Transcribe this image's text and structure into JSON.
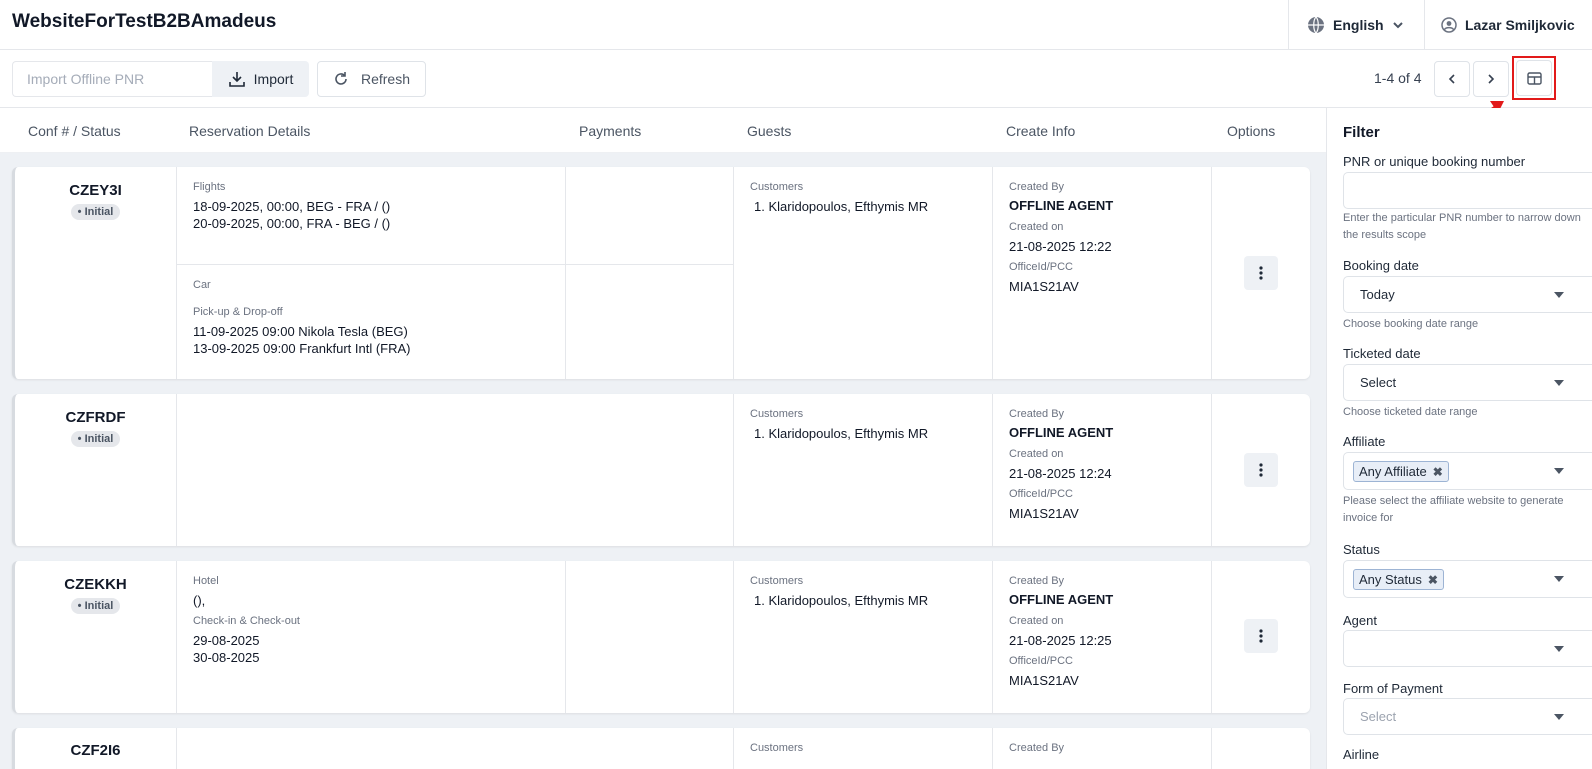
{
  "header": {
    "app_title": "WebsiteForTestB2BAmadeus",
    "language": "English",
    "user_name": "Lazar Smiljkovic"
  },
  "toolbar": {
    "pnr_placeholder": "Import Offline PNR",
    "import_label": "Import",
    "refresh_label": "Refresh",
    "pager_text": "1-4 of 4"
  },
  "columns": {
    "conf_status": "Conf # / Status",
    "reservation_details": "Reservation Details",
    "payments": "Payments",
    "guests": "Guests",
    "create_info": "Create Info",
    "options": "Options"
  },
  "bookings": [
    {
      "conf": "CZEY3I",
      "status": "• Initial",
      "flights_label": "Flights",
      "flight_1": "18-09-2025, 00:00, BEG - FRA / ()",
      "flight_2": "20-09-2025, 00:00, FRA - BEG / ()",
      "car_label": "Car",
      "pickup_label": "Pick-up & Drop-off",
      "pickup_1": "11-09-2025 09:00 Nikola Tesla (BEG)",
      "pickup_2": "13-09-2025 09:00 Frankfurt Intl (FRA)",
      "customers_label": "Customers",
      "customer": "1. Klaridopoulos, Efthymis MR",
      "created_by_label": "Created By",
      "created_by": "OFFLINE AGENT",
      "created_on_label": "Created on",
      "created_on": "21-08-2025 12:22",
      "office_label": "OfficeId/PCC",
      "office": "MIA1S21AV"
    },
    {
      "conf": "CZFRDF",
      "status": "• Initial",
      "customers_label": "Customers",
      "customer": "1. Klaridopoulos, Efthymis MR",
      "created_by_label": "Created By",
      "created_by": "OFFLINE AGENT",
      "created_on_label": "Created on",
      "created_on": "21-08-2025 12:24",
      "office_label": "OfficeId/PCC",
      "office": "MIA1S21AV"
    },
    {
      "conf": "CZEKKH",
      "status": "• Initial",
      "hotel_label": "Hotel",
      "hotel_name": "(),",
      "checkin_label": "Check-in & Check-out",
      "checkin": "29-08-2025",
      "checkout": "30-08-2025",
      "customers_label": "Customers",
      "customer": "1. Klaridopoulos, Efthymis MR",
      "created_by_label": "Created By",
      "created_by": "OFFLINE AGENT",
      "created_on_label": "Created on",
      "created_on": "21-08-2025 12:25",
      "office_label": "OfficeId/PCC",
      "office": "MIA1S21AV"
    },
    {
      "conf": "CZF2I6",
      "customers_label": "Customers",
      "created_by_label": "Created By"
    }
  ],
  "filter": {
    "title": "Filter",
    "pnr_label": "PNR or unique booking number",
    "pnr_help": "Enter the particular PNR number to narrow down the results scope",
    "booking_date_label": "Booking date",
    "booking_date_value": "Today",
    "booking_date_help": "Choose booking date range",
    "ticketed_date_label": "Ticketed date",
    "ticketed_date_value": "Select",
    "ticketed_date_help": "Choose ticketed date range",
    "affiliate_label": "Affiliate",
    "affiliate_tag": "Any Affiliate",
    "affiliate_help": "Please select the affiliate website to generate invoice for",
    "status_label": "Status",
    "status_tag": "Any Status",
    "agent_label": "Agent",
    "form_of_payment_label": "Form of Payment",
    "form_of_payment_placeholder": "Select",
    "airline_label": "Airline",
    "tag_remove": "✖"
  },
  "colors": {
    "highlight": "#e21a1a",
    "background": "#eef1f5"
  }
}
